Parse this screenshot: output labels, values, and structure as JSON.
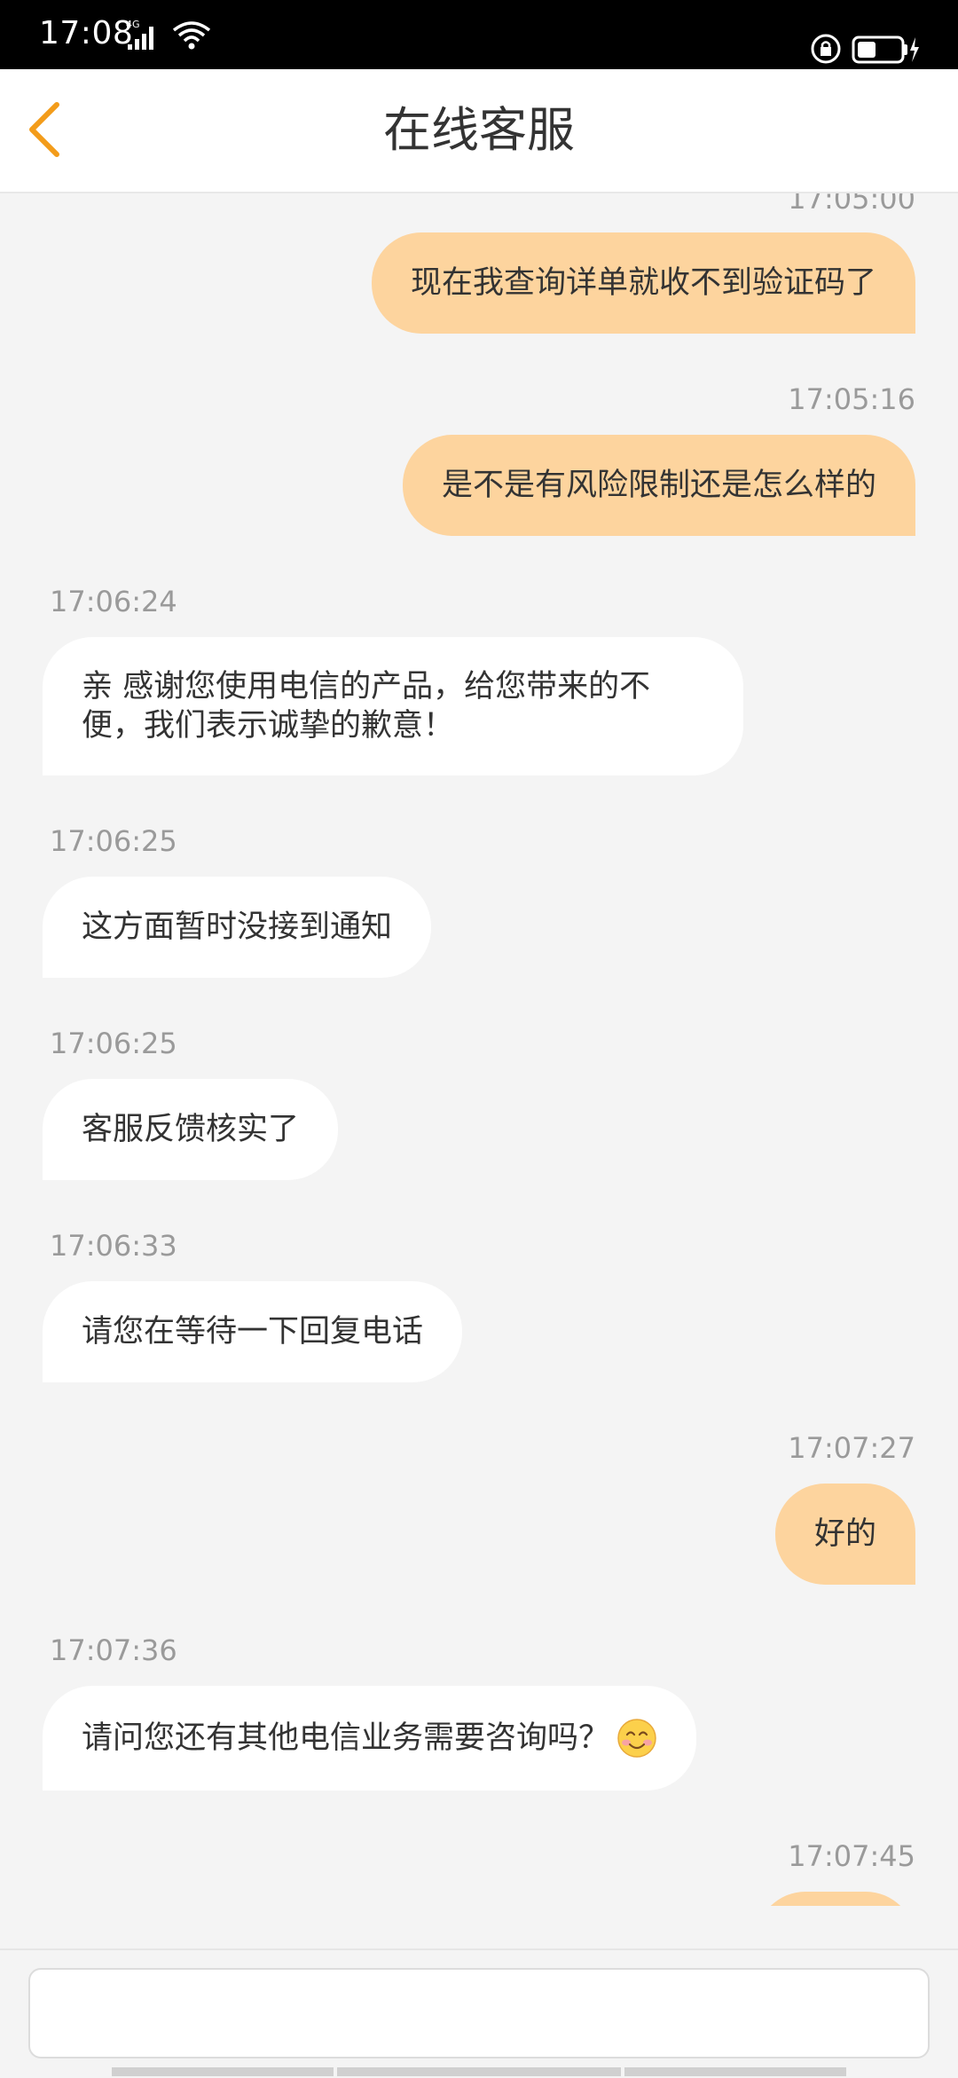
{
  "status_bar": {
    "time": "17:08",
    "network_label": "4G",
    "colors": {
      "background": "#000000",
      "foreground": "#ffffff"
    }
  },
  "header": {
    "title": "在线客服",
    "back_icon": "chevron-left-icon",
    "accent_color": "#f39c1a"
  },
  "messages": [
    {
      "side": "out",
      "time": "17:05:00",
      "text": "现在我查询详单就收不到验证码了"
    },
    {
      "side": "out",
      "time": "17:05:16",
      "text": "是不是有风险限制还是怎么样的"
    },
    {
      "side": "in",
      "time": "17:06:24",
      "text": "亲 感谢您使用电信的产品，给您带来的不便，我们表示诚挚的歉意！"
    },
    {
      "side": "in",
      "time": "17:06:25",
      "text": "这方面暂时没接到通知"
    },
    {
      "side": "in",
      "time": "17:06:25",
      "text": "客服反馈核实了"
    },
    {
      "side": "in",
      "time": "17:06:33",
      "text": "请您在等待一下回复电话"
    },
    {
      "side": "out",
      "time": "17:07:27",
      "text": "好的"
    },
    {
      "side": "in",
      "time": "17:07:36",
      "text": "请问您还有其他电信业务需要咨询吗？",
      "emoji": "smiling-face-icon"
    },
    {
      "side": "out",
      "time": "17:07:45",
      "text": ""
    }
  ],
  "input": {
    "value": "",
    "placeholder": ""
  },
  "colors": {
    "outgoing_bubble": "#fdd49e",
    "incoming_bubble": "#ffffff",
    "background": "#f4f4f4",
    "timestamp": "#9a9a9a"
  }
}
